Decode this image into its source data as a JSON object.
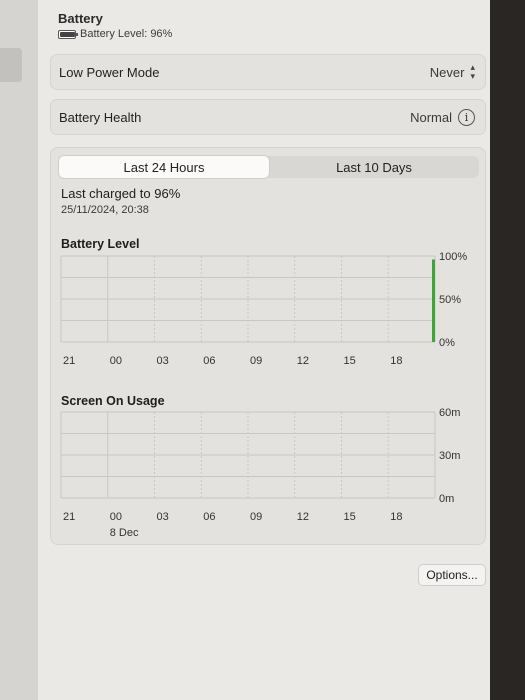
{
  "header": {
    "title": "Battery",
    "battery_level_text": "Battery Level: 96%"
  },
  "low_power": {
    "label": "Low Power Mode",
    "value": "Never"
  },
  "health": {
    "label": "Battery Health",
    "value": "Normal"
  },
  "tabs": [
    {
      "label": "Last 24 Hours",
      "selected": true
    },
    {
      "label": "Last 10 Days",
      "selected": false
    }
  ],
  "last_charged": {
    "title": "Last charged to 96%",
    "date": "25/11/2024, 20:38"
  },
  "chart_data": [
    {
      "type": "bar",
      "title": "Battery Level",
      "categories": [
        "21",
        "00",
        "03",
        "06",
        "09",
        "12",
        "15",
        "18"
      ],
      "y_ticks": [
        "100%",
        "50%",
        "0%"
      ],
      "ylim": [
        0,
        100
      ],
      "bar_color": "#3fa535",
      "last_value": 96
    },
    {
      "type": "bar",
      "title": "Screen On Usage",
      "categories": [
        "21",
        "00",
        "03",
        "06",
        "09",
        "12",
        "15",
        "18"
      ],
      "date_label": "8 Dec",
      "y_ticks": [
        "60m",
        "30m",
        "0m"
      ],
      "ylim": [
        0,
        60
      ]
    }
  ],
  "footer": {
    "options_label": "Options...",
    "help_label": "?"
  },
  "colors": {
    "accent_green": "#3fa535",
    "window_bg": "#ebe9e5"
  }
}
